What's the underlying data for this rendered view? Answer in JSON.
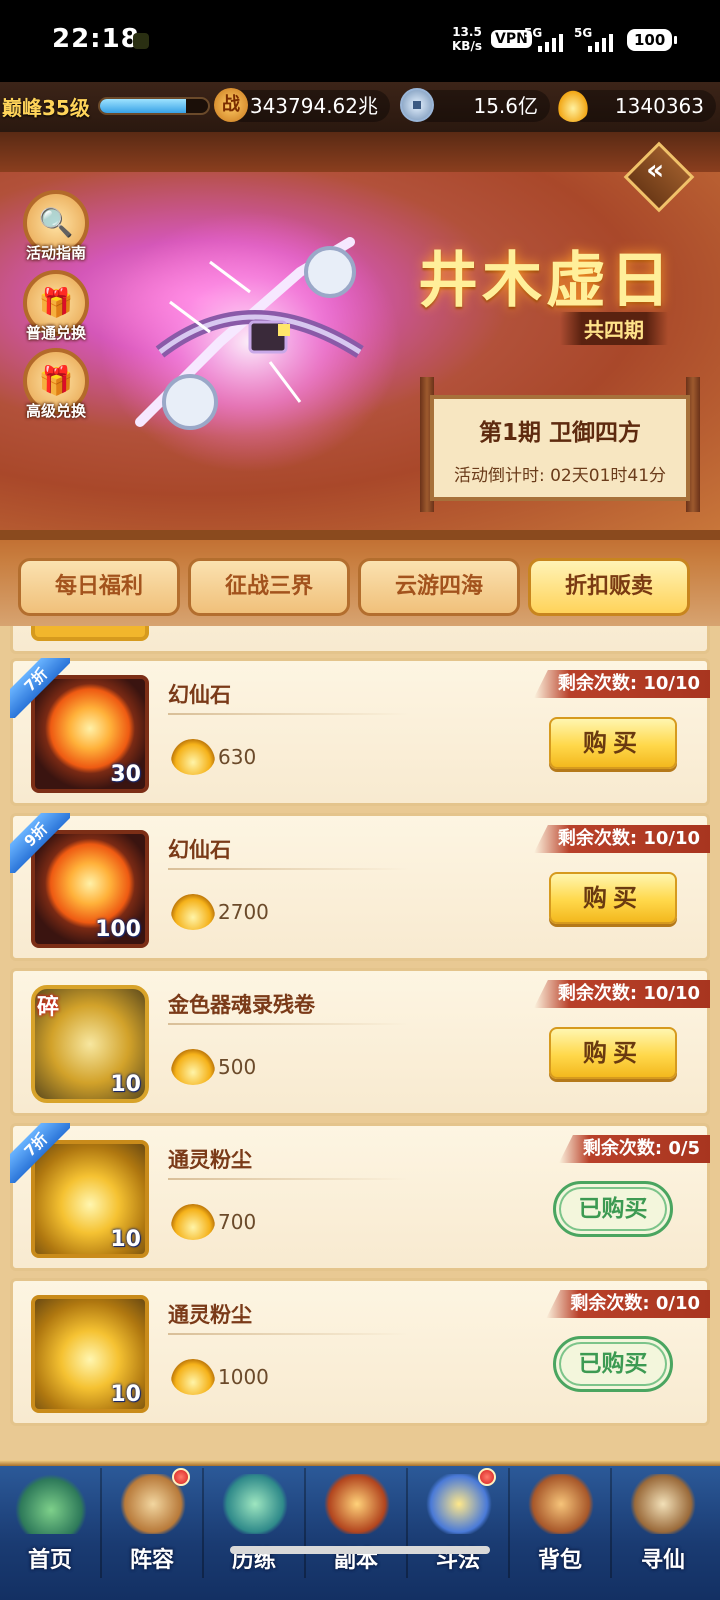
{
  "status_bar": {
    "time": "22:18",
    "net_speed_value": "13.5",
    "net_speed_unit": "KB/s",
    "vpn": "VPN",
    "signal1": "5G",
    "signal2": "5G",
    "battery": "100"
  },
  "resources": {
    "level": "巅峰35级",
    "exp_progress": 0.8,
    "zhan_icon": "战",
    "power": "343794.62兆",
    "copper": "15.6亿",
    "ingots": "1340363"
  },
  "sidebar": [
    {
      "label": "活动指南",
      "icon": "magnifier-icon",
      "glyph": "🔍"
    },
    {
      "label": "普通兑换",
      "icon": "chest-icon",
      "glyph": "🎁"
    },
    {
      "label": "高级兑换",
      "icon": "gift-icon",
      "glyph": "🎁"
    }
  ],
  "event": {
    "title": "井木虚日",
    "subtitle": "共四期",
    "period": "第1期  卫御四方",
    "countdown": "活动倒计时: 02天01时41分",
    "back_glyph": "«"
  },
  "tabs": [
    {
      "label": "每日福利",
      "active": false
    },
    {
      "label": "征战三界",
      "active": false
    },
    {
      "label": "云游四海",
      "active": false
    },
    {
      "label": "折扣贩卖",
      "active": true
    }
  ],
  "items": [
    {
      "name": "幻仙石",
      "qty": "30",
      "discount": "7折",
      "price": "630",
      "remaining": "剩余次数: 10/10",
      "action": "购买",
      "status": "buy"
    },
    {
      "name": "幻仙石",
      "qty": "100",
      "discount": "9折",
      "price": "2700",
      "remaining": "剩余次数: 10/10",
      "action": "购买",
      "status": "buy"
    },
    {
      "name": "金色器魂录残卷",
      "qty": "10",
      "fragment": "碎",
      "price": "500",
      "remaining": "剩余次数: 10/10",
      "action": "购买",
      "status": "buy"
    },
    {
      "name": "通灵粉尘",
      "qty": "10",
      "discount": "7折",
      "price": "700",
      "remaining": "剩余次数: 0/5",
      "action": "已购买",
      "status": "bought"
    },
    {
      "name": "通灵粉尘",
      "qty": "10",
      "price": "1000",
      "remaining": "剩余次数: 0/10",
      "action": "已购买",
      "status": "bought"
    }
  ],
  "bottom_nav": [
    {
      "label": "首页",
      "icon": "island-icon",
      "dot": false
    },
    {
      "label": "阵容",
      "icon": "cards-icon",
      "dot": true
    },
    {
      "label": "历练",
      "icon": "beast-icon",
      "dot": false
    },
    {
      "label": "副本",
      "icon": "gate-icon",
      "dot": false
    },
    {
      "label": "斗法",
      "icon": "helmet-icon",
      "dot": true
    },
    {
      "label": "背包",
      "icon": "bag-icon",
      "dot": false
    },
    {
      "label": "寻仙",
      "icon": "scroll-icon",
      "dot": false
    }
  ],
  "colors": {
    "accent_gold": "#ffd84a",
    "remain_tag": "#b9412a",
    "bought_green": "#3c9a52",
    "discount_blue": "#2a74d8"
  }
}
